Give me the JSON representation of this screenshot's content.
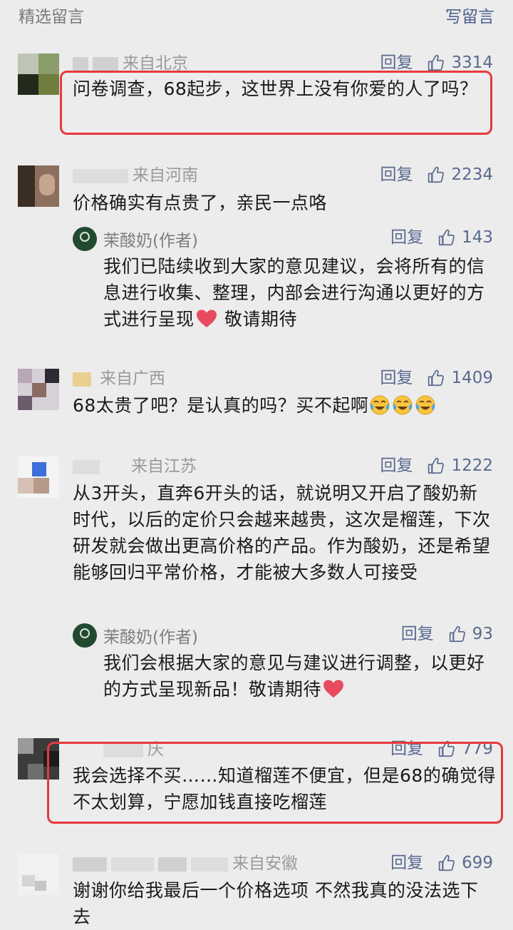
{
  "header": {
    "title": "精选留言",
    "write_label": "写留言"
  },
  "colors": {
    "accent": "#5a6a8e",
    "highlight_border": "#e8383d",
    "author_avatar": "#224a30"
  },
  "icons": {
    "like": "thumbs-up-icon",
    "heart": "red-heart-emoji",
    "tears": "tears-of-joy-emoji"
  },
  "comments": [
    {
      "location": "来自北京",
      "reply": "回复",
      "likes": "3314",
      "text": "问卷调查，68起步，这世界上没有你爱的人了吗？"
    },
    {
      "location": "来自河南",
      "reply": "回复",
      "likes": "2234",
      "text": "价格确实有点贵了，亲民一点咯",
      "author_reply": {
        "name": "茉酸奶(作者)",
        "reply": "回复",
        "likes": "143",
        "text": "我们已陆续收到大家的意见建议，会将所有的信息进行收集、整理，内部会进行沟通以更好的方式进行呈现",
        "tail": "敬请期待"
      }
    },
    {
      "location": "来自广西",
      "reply": "回复",
      "likes": "1409",
      "text": "68太贵了吧？是认真的吗？买不起啊"
    },
    {
      "location": "来自江苏",
      "reply": "回复",
      "likes": "1222",
      "text": "从3开头，直奔6开头的话，就说明又开启了酸奶新时代，以后的定价只会越来越贵，这次是榴莲，下次研发就会做出更高价格的产品。作为酸奶，还是希望能够回归平常价格，才能被大多数人可接受",
      "author_reply": {
        "name": "茉酸奶(作者)",
        "reply": "回复",
        "likes": "93",
        "text": "我们会根据大家的意见与建议进行调整，以更好的方式呈现新品！敬请期待"
      }
    },
    {
      "location": "庆",
      "reply": "回复",
      "likes": "779",
      "text": "我会选择不买……知道榴莲不便宜，但是68的确觉得不太划算，宁愿加钱直接吃榴莲"
    },
    {
      "location": "来自安徽",
      "reply": "回复",
      "likes": "699",
      "text": "谢谢你给我最后一个价格选项 不然我真的没法选下去"
    }
  ]
}
